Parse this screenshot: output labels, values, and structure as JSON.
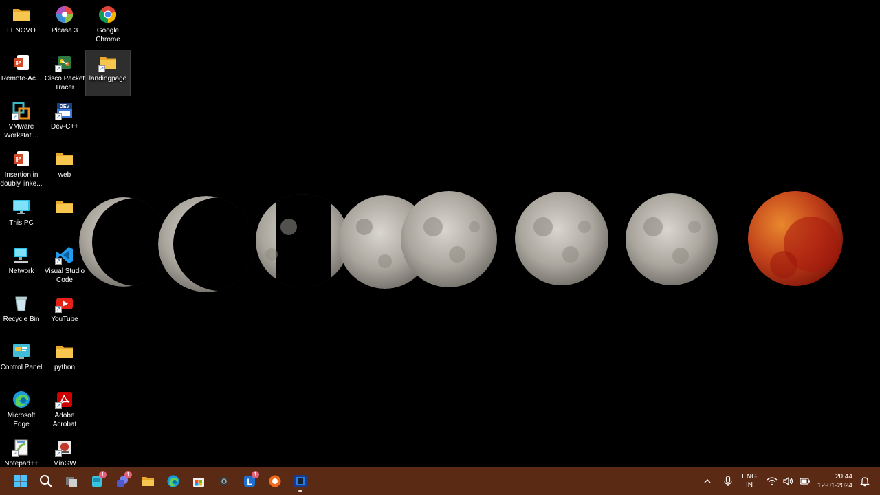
{
  "desktop": {
    "icons": [
      {
        "label": "LENOVO",
        "icon": "folder-icon"
      },
      {
        "label": "Picasa 3",
        "icon": "picasa-icon"
      },
      {
        "label": "Google Chrome",
        "icon": "chrome-icon"
      },
      {
        "label": "Remote-Ac...",
        "icon": "powerpoint-icon"
      },
      {
        "label": "Cisco Packet Tracer",
        "icon": "cisco-packet-tracer-icon"
      },
      {
        "label": "landingpage",
        "icon": "folder-shortcut-icon"
      },
      {
        "label": "VMware Workstati...",
        "icon": "vmware-icon"
      },
      {
        "label": "Dev-C++",
        "icon": "dev-cpp-icon"
      },
      {
        "label": "Insertion in doubly linke...",
        "icon": "powerpoint-icon"
      },
      {
        "label": "web",
        "icon": "folder-icon"
      },
      {
        "label": "This PC",
        "icon": "monitor-icon"
      },
      {
        "label": "",
        "icon": "folder-icon"
      },
      {
        "label": "Network",
        "icon": "network-icon"
      },
      {
        "label": "Visual Studio Code",
        "icon": "vscode-icon"
      },
      {
        "label": "Recycle Bin",
        "icon": "recycle-bin-icon"
      },
      {
        "label": "YouTube",
        "icon": "youtube-icon"
      },
      {
        "label": "Control Panel",
        "icon": "control-panel-icon"
      },
      {
        "label": "python",
        "icon": "folder-icon"
      },
      {
        "label": "Microsoft Edge",
        "icon": "edge-icon"
      },
      {
        "label": "Adobe Acrobat",
        "icon": "acrobat-icon"
      },
      {
        "label": "Notepad++",
        "icon": "notepadpp-icon"
      },
      {
        "label": "MinGW",
        "icon": "mingw-icon"
      }
    ]
  },
  "taskbar": {
    "apps": [
      {
        "icon": "windows-start-icon"
      },
      {
        "icon": "search-icon"
      },
      {
        "icon": "task-view-icon"
      },
      {
        "icon": "widgets-icon",
        "badge": "1"
      },
      {
        "icon": "teams-chat-icon",
        "badge": "1"
      },
      {
        "icon": "file-explorer-icon"
      },
      {
        "icon": "edge-icon"
      },
      {
        "icon": "microsoft-store-icon"
      },
      {
        "icon": "camera-icon"
      },
      {
        "icon": "lenovo-vantage-icon",
        "badge": "1"
      },
      {
        "icon": "avast-icon"
      },
      {
        "icon": "media-app-icon",
        "running": true
      }
    ],
    "tray": {
      "lang_top": "ENG",
      "lang_bottom": "IN",
      "time": "20:44",
      "date": "12-01-2024"
    }
  },
  "colors": {
    "taskbar": "#5b2a14",
    "wallpaper": "#000000",
    "folder": "#f4c04a",
    "blood_moon": "#c0331a"
  }
}
